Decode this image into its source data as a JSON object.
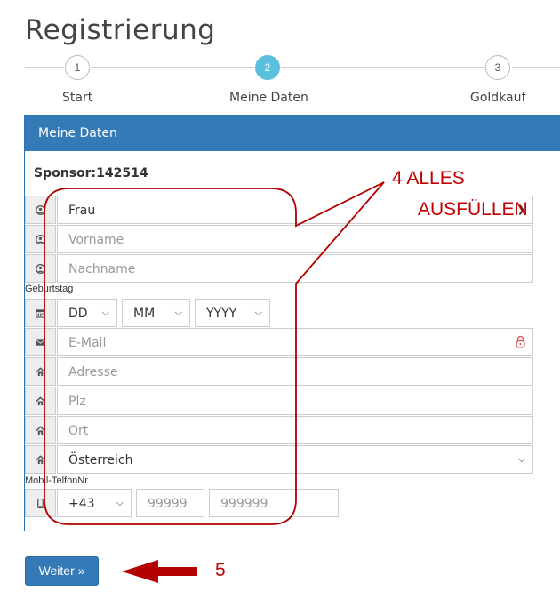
{
  "page": {
    "title": "Registrierung"
  },
  "steps": [
    {
      "number": "1",
      "label": "Start"
    },
    {
      "number": "2",
      "label": "Meine Daten"
    },
    {
      "number": "3",
      "label": "Goldkauf"
    }
  ],
  "panel": {
    "heading": "Meine Daten",
    "sponsor": "Sponsor:142514"
  },
  "form": {
    "salutation": "Frau",
    "first_name_placeholder": "Vorname",
    "last_name_placeholder": "Nachname",
    "birthday_label": "Geburtstag",
    "day_select": "DD",
    "month_select": "MM",
    "year_select": "YYYY",
    "email_placeholder": "E-Mail",
    "address_placeholder": "Adresse",
    "zip_placeholder": "Plz",
    "city_placeholder": "Ort",
    "country": "Österreich",
    "phone_label": "Mobil-TelfonNr",
    "phone_prefix": "+43",
    "area_placeholder": "99999",
    "number_placeholder": "999999"
  },
  "button": {
    "next_label": "Weiter »"
  },
  "annotations": {
    "step4_line1": "4  ALLES",
    "step4_line2": "AUSFÜLLEN",
    "step5": "5"
  },
  "colors": {
    "primary": "#337ab7",
    "active_step": "#5bc0de",
    "annotation": "#c00000",
    "lock_icon": "#d9534f"
  }
}
